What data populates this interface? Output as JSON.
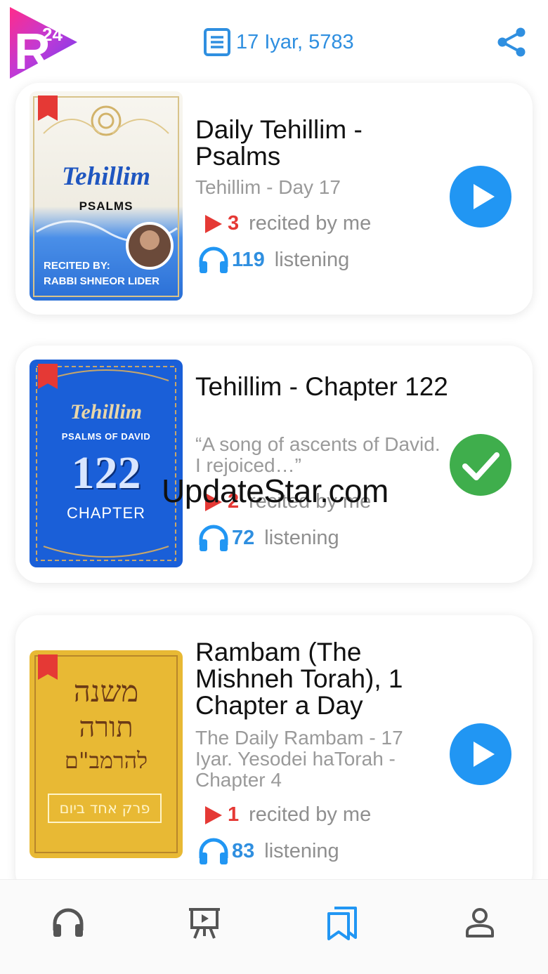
{
  "header": {
    "logo_text": "R24",
    "date": "17 Iyar, 5783"
  },
  "cards": [
    {
      "title": "Daily Tehillim - Psalms",
      "subtitle": "Tehillim - Day 17",
      "recited_count": "3",
      "recited_label": "recited by me",
      "listening_count": "119",
      "listening_label": "listening",
      "action": "play",
      "cover": {
        "title": "Tehillim",
        "subtitle": "PSALMS",
        "credit_line1": "RECITED BY:",
        "credit_line2": "RABBI SHNEOR LIDER"
      }
    },
    {
      "title": "Tehillim - Chapter 122",
      "subtitle": "“A song of ascents of David. I rejoiced…”",
      "recited_count": "2",
      "recited_label": "recited by me",
      "listening_count": "72",
      "listening_label": "listening",
      "action": "done",
      "cover": {
        "title": "Tehillim",
        "subtitle": "PSALMS OF DAVID",
        "number": "122",
        "label": "CHAPTER"
      }
    },
    {
      "title": "Rambam (The Mishneh Torah), 1 Chapter a Day",
      "subtitle": "The Daily Rambam - 17 Iyar. Yesodei haTorah - Chapter 4",
      "recited_count": "1",
      "recited_label": "recited by me",
      "listening_count": "83",
      "listening_label": "listening",
      "action": "play",
      "cover": {
        "line1": "משנה",
        "line2": "תורה",
        "line3": "להרמב\"ם",
        "box": "פרק אחד ביום"
      }
    }
  ],
  "watermark": "UpdateStar.com",
  "nav": {
    "items": [
      "headphones-icon",
      "presentation-icon",
      "bookmarks-icon",
      "person-icon"
    ],
    "active_index": 2
  },
  "colors": {
    "accent_blue": "#2196f3",
    "text_blue": "#2f8fe0",
    "red": "#e53935",
    "green": "#3fae4c",
    "nav_gray": "#555555"
  }
}
